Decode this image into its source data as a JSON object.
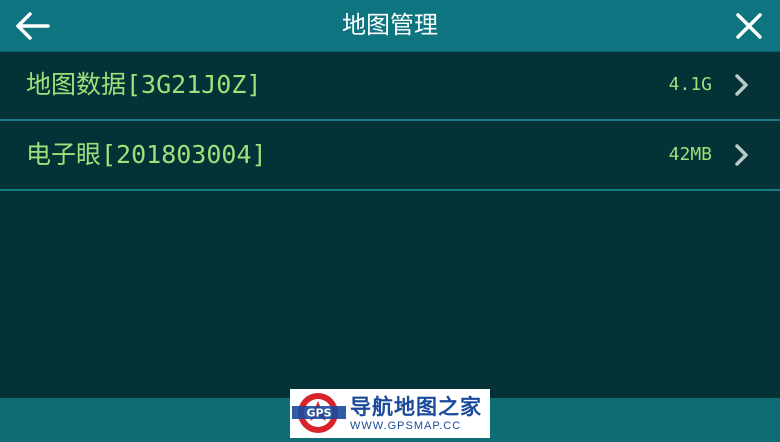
{
  "header": {
    "title": "地图管理",
    "back_icon": "arrow-left-icon",
    "close_icon": "close-icon"
  },
  "list": {
    "items": [
      {
        "label": "地图数据[3G21J0Z]",
        "size": "4.1G",
        "icon": "chevron-right-icon"
      },
      {
        "label": "电子眼[201803004]",
        "size": "42MB",
        "icon": "chevron-right-icon"
      }
    ]
  },
  "watermark": {
    "logo_text": "GPS",
    "title": "导航地图之家",
    "url": "WWW.GPSMAP.CC"
  },
  "colors": {
    "header_bg": "#0e7580",
    "body_bg": "#053236",
    "text_green": "#9ce27a",
    "divider": "#167a84"
  }
}
